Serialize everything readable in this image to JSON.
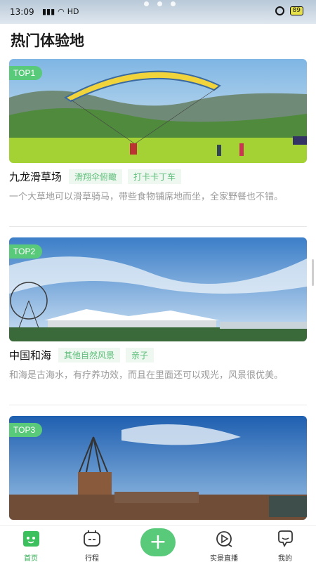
{
  "status_bar": {
    "time": "13:09",
    "network": "HD",
    "battery": "89"
  },
  "page": {
    "title": "热门体验地"
  },
  "cards": [
    {
      "rank": "TOP1",
      "name": "九龙滑草场",
      "tags": [
        "滑翔伞俯瞰",
        "打卡卡丁车"
      ],
      "description": "一个大草地可以滑草骑马，带些食物铺席地而坐，全家野餐也不错。"
    },
    {
      "rank": "TOP2",
      "name": "中国和海",
      "tags": [
        "其他自然风景",
        "亲子"
      ],
      "description": "和海是古海水，有疗养功效，而且在里面还可以观光，风景很优美。"
    },
    {
      "rank": "TOP3",
      "name": "",
      "tags": [],
      "description": ""
    }
  ],
  "tabbar": {
    "items": [
      {
        "label": "首页",
        "icon": "home-icon"
      },
      {
        "label": "行程",
        "icon": "itinerary-icon"
      },
      {
        "label": "",
        "icon": "add-icon"
      },
      {
        "label": "实景直播",
        "icon": "live-icon"
      },
      {
        "label": "我的",
        "icon": "profile-icon"
      }
    ]
  },
  "colors": {
    "accent": "#59c97a",
    "tag_text": "#5fbf7a",
    "tag_bg": "#eef8f0",
    "desc": "#9a9a9a"
  }
}
